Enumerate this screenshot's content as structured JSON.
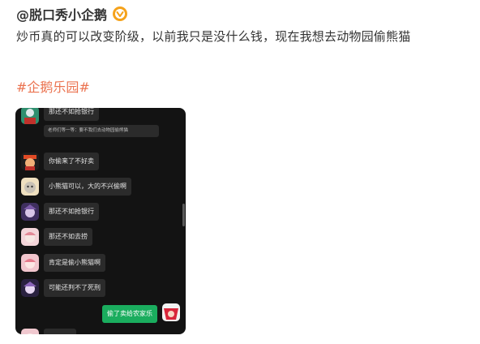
{
  "post": {
    "username": "@脱口秀小企鹅",
    "text": "炒币真的可以改变阶级，以前我只是没什么钱，现在我想去动物园偷熊猫",
    "hashtag": "#企鹅乐园#"
  },
  "chat": {
    "messages": [
      {
        "text": "那还不如抢银行",
        "avatar_color": "#3a8f6a"
      },
      {
        "text": "老师们等一等：要不我们去动物园偷熊猫",
        "avatar_color": ""
      },
      {
        "text": "你偷来了不好卖",
        "avatar_color": "#d24a2c"
      },
      {
        "text": "小熊猫可以，大的不兴偷啊",
        "avatar_color": "#e9c98a"
      },
      {
        "text": "那还不如抢银行",
        "avatar_color": "#6a4e8c"
      },
      {
        "text": "那还不如去捞",
        "avatar_color": "#e7a9b0"
      },
      {
        "text": "肯定是偷小熊猫啊",
        "avatar_color": "#e98f9c"
      },
      {
        "text": "可能还判不了死刑",
        "avatar_color": "#7a5aa0"
      },
      {
        "text": "偷了卖给农家乐",
        "avatar_color": "#d8263a",
        "self": true
      },
      {
        "text": "",
        "avatar_color": "#e8a5b0"
      }
    ]
  },
  "colors": {
    "hashtag": "#eb7350",
    "verified": "#f5a21b",
    "chat_bg": "#131313",
    "bubble": "#2b2b2b",
    "self_bubble": "#1aad5e"
  },
  "icons": {
    "verified": "verified-badge-icon"
  }
}
